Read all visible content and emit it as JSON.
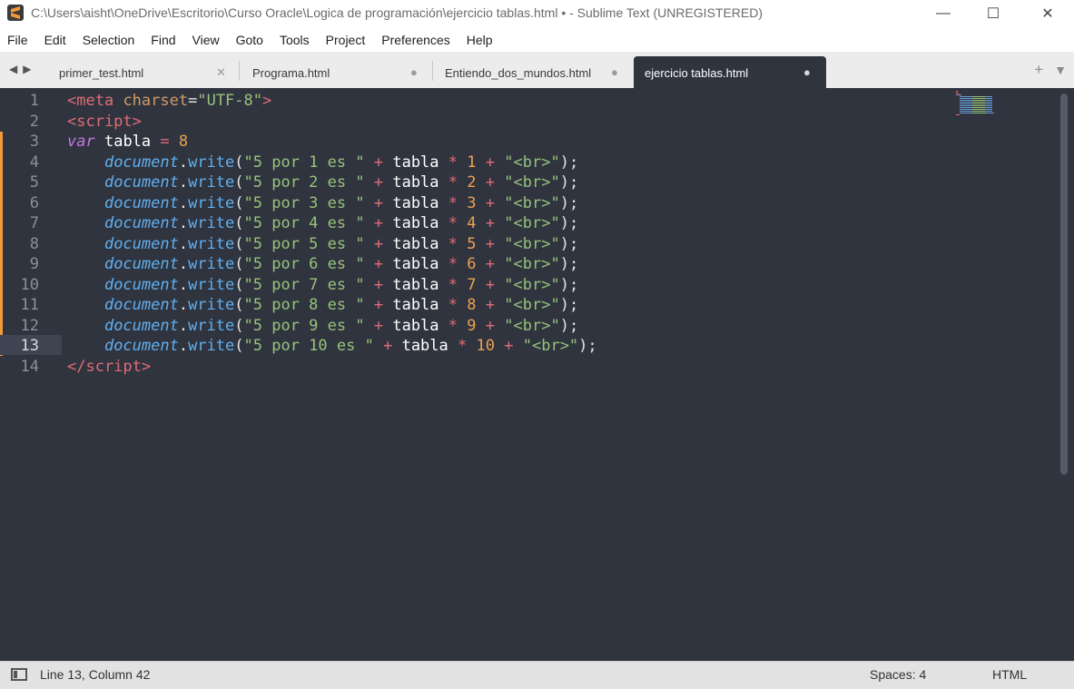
{
  "window": {
    "title": "C:\\Users\\aisht\\OneDrive\\Escritorio\\Curso Oracle\\Logica de programación\\ejercicio tablas.html • - Sublime Text (UNREGISTERED)",
    "minimize_glyph": "—",
    "maximize_glyph": "☐",
    "close_glyph": "✕"
  },
  "menu": {
    "items": [
      {
        "label": "File"
      },
      {
        "label": "Edit"
      },
      {
        "label": "Selection"
      },
      {
        "label": "Find"
      },
      {
        "label": "View"
      },
      {
        "label": "Goto"
      },
      {
        "label": "Tools"
      },
      {
        "label": "Project"
      },
      {
        "label": "Preferences"
      },
      {
        "label": "Help"
      }
    ]
  },
  "tabbar": {
    "back_glyph": "◀",
    "forward_glyph": "▶",
    "new_tab_glyph": "+",
    "tab_menu_glyph": "▼",
    "tabs": [
      {
        "label": "primer_test.html",
        "close_glyph": "✕",
        "active": false
      },
      {
        "label": "Programa.html",
        "close_glyph": "●",
        "active": false
      },
      {
        "label": "Entiendo_dos_mundos.html",
        "close_glyph": "●",
        "active": false
      },
      {
        "label": "ejercicio tablas.html",
        "close_glyph": "●",
        "active": true
      }
    ]
  },
  "editor": {
    "current_line": 13,
    "line_numbers": [
      "1",
      "2",
      "3",
      "4",
      "5",
      "6",
      "7",
      "8",
      "9",
      "10",
      "11",
      "12",
      "13",
      "14"
    ],
    "colors": {
      "background": "#2f343f",
      "modified_marker": "#f29a39"
    }
  },
  "status": {
    "position": "Line 13, Column 42",
    "indent": "Spaces: 4",
    "syntax": "HTML"
  }
}
